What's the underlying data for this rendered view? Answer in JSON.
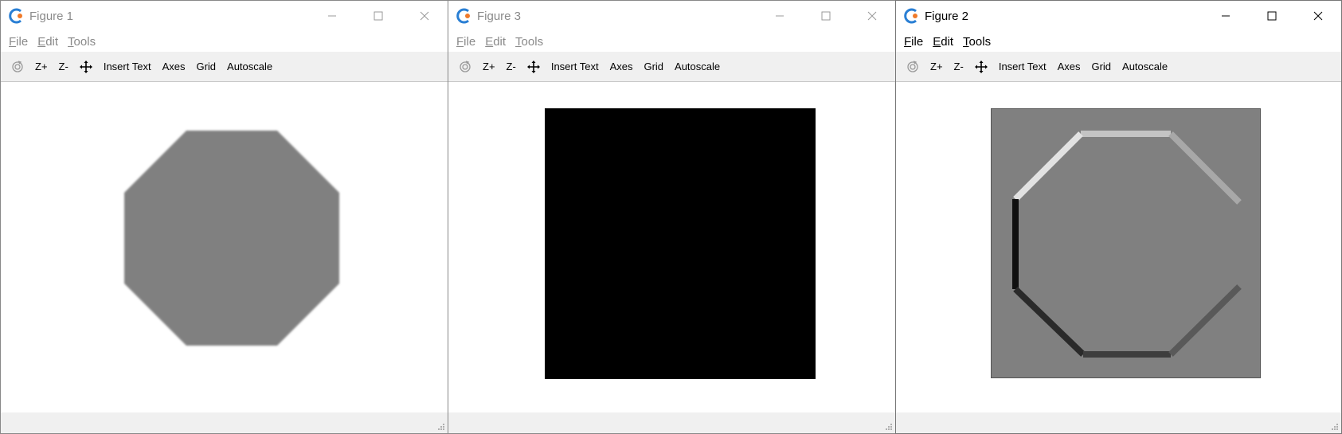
{
  "windows": [
    {
      "id": "win1",
      "title": "Figure 1",
      "active": false,
      "menu": [
        {
          "mnemonic": "F",
          "rest": "ile"
        },
        {
          "mnemonic": "E",
          "rest": "dit"
        },
        {
          "mnemonic": "T",
          "rest": "ools"
        }
      ],
      "toolbar": [
        "Z+",
        "Z-",
        "Insert Text",
        "Axes",
        "Grid",
        "Autoscale"
      ],
      "image": {
        "kind": "octagon-filled",
        "fill": "#808080"
      }
    },
    {
      "id": "win3",
      "title": "Figure 3",
      "active": false,
      "menu": [
        {
          "mnemonic": "F",
          "rest": "ile"
        },
        {
          "mnemonic": "E",
          "rest": "dit"
        },
        {
          "mnemonic": "T",
          "rest": "ools"
        }
      ],
      "toolbar": [
        "Z+",
        "Z-",
        "Insert Text",
        "Axes",
        "Grid",
        "Autoscale"
      ],
      "image": {
        "kind": "black-square",
        "fill": "#000000"
      }
    },
    {
      "id": "win2",
      "title": "Figure 2",
      "active": true,
      "menu": [
        {
          "mnemonic": "F",
          "rest": "ile"
        },
        {
          "mnemonic": "E",
          "rest": "dit"
        },
        {
          "mnemonic": "T",
          "rest": "ools"
        }
      ],
      "toolbar": [
        "Z+",
        "Z-",
        "Insert Text",
        "Axes",
        "Grid",
        "Autoscale"
      ],
      "image": {
        "kind": "octagon-gradient-edges",
        "background": "#808080"
      }
    }
  ],
  "icons": {
    "app": "octave-logo-icon",
    "minimize": "minimize-icon",
    "maximize": "maximize-icon",
    "close": "close-icon",
    "rotate": "rotate-icon",
    "pan": "pan-move-icon",
    "grip": "resize-grip-icon"
  }
}
